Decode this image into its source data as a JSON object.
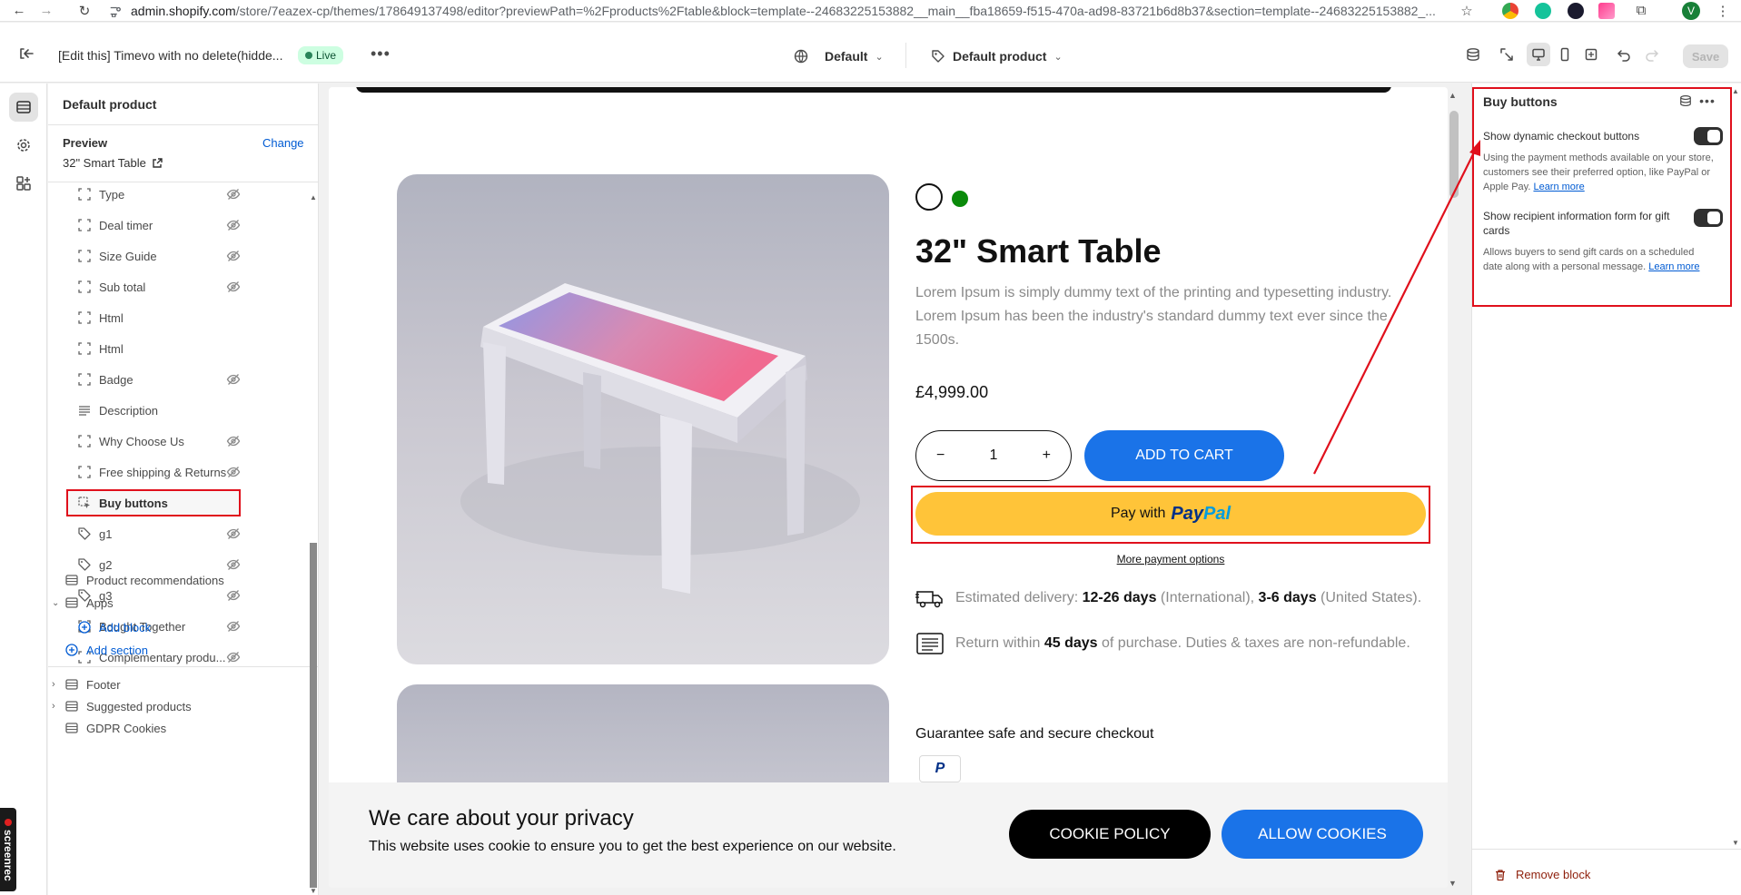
{
  "browser": {
    "url_main": "admin.shopify.com",
    "url_rest": "/store/7eazex-cp/themes/178649137498/editor?previewPath=%2Fproducts%2Ftable&block=template--24683225153882__main__fba18659-f515-470a-ad98-83721b6d8b37&section=template--24683225153882_...",
    "avatar_letter": "V"
  },
  "topbar": {
    "theme_title": "[Edit this] Timevo with no delete(hidde...",
    "live_badge": "Live",
    "template_dropdown": "Default",
    "product_dropdown": "Default product",
    "save_label": "Save"
  },
  "sidebar": {
    "heading": "Default product",
    "preview_label": "Preview",
    "change_link": "Change",
    "preview_product": "32\" Smart Table",
    "blocks": [
      {
        "label": "Type",
        "hidden": true
      },
      {
        "label": "Deal timer",
        "hidden": true
      },
      {
        "label": "Size Guide",
        "hidden": true
      },
      {
        "label": "Sub total",
        "hidden": true
      },
      {
        "label": "Html",
        "hidden": false
      },
      {
        "label": "Html",
        "hidden": false
      },
      {
        "label": "Badge",
        "hidden": true
      },
      {
        "label": "Description",
        "hidden": false
      },
      {
        "label": "Why Choose Us",
        "hidden": true
      },
      {
        "label": "Free shipping & Returns",
        "hidden": true
      },
      {
        "label": "Buy buttons",
        "hidden": false,
        "selected": true
      },
      {
        "label": "g1",
        "hidden": true
      },
      {
        "label": "g2",
        "hidden": true
      },
      {
        "label": "g3",
        "hidden": true
      },
      {
        "label": "Bought Together",
        "hidden": true
      },
      {
        "label": "Complementary produ...",
        "hidden": true
      }
    ],
    "sections": {
      "product_recommendations": "Product recommendations",
      "apps": "Apps",
      "add_block": "Add block",
      "add_section": "Add section",
      "footer": "Footer",
      "suggested_products": "Suggested products",
      "gdpr_cookies": "GDPR Cookies"
    }
  },
  "product": {
    "title": "32\" Smart Table",
    "description": "Lorem Ipsum is simply dummy text of the printing and typesetting industry. Lorem Ipsum has been the industry's standard dummy text ever since the 1500s.",
    "price": "£4,999.00",
    "quantity": "1",
    "qty_minus": "−",
    "qty_plus": "+",
    "add_to_cart": "ADD TO CART",
    "paypal_prefix": "Pay with",
    "paypal_brand_1": "Pay",
    "paypal_brand_2": "Pal",
    "more_payment": "More payment options",
    "delivery_prefix": "Estimated delivery:",
    "delivery_days_intl": "12-26 days",
    "delivery_intl": "(International),",
    "delivery_days_us": "3-6 days",
    "delivery_us": "(United States).",
    "return_prefix": "Return within",
    "return_days": "45 days",
    "return_suffix": "of purchase. Duties & taxes are non-refundable.",
    "guarantee": "Guarantee safe and secure checkout",
    "swatch_colors": [
      "#ffffff",
      "#0a8a0a"
    ]
  },
  "cookie": {
    "title": "We care about your privacy",
    "text": "This website uses cookie to ensure you to get the best experience on our website.",
    "policy_button": "COOKIE POLICY",
    "allow_button": "ALLOW COOKIES"
  },
  "panel": {
    "title": "Buy buttons",
    "setting1_label": "Show dynamic checkout buttons",
    "setting1_help": "Using the payment methods available on your store, customers see their preferred option, like PayPal or Apple Pay.",
    "setting1_link": "Learn more",
    "setting1_on": true,
    "setting2_label": "Show recipient information form for gift cards",
    "setting2_help": "Allows buyers to send gift cards on a scheduled date along with a personal message.",
    "setting2_link": "Learn more",
    "setting2_on": true,
    "remove_block": "Remove block"
  },
  "colors": {
    "annotation_red": "#e0101c",
    "primary_blue": "#1a73e8",
    "paypal_yellow": "#ffc439"
  },
  "screenrec_label": "screenrec"
}
